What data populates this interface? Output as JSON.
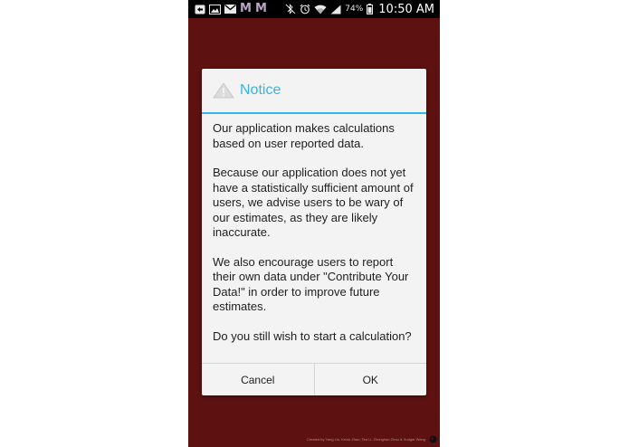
{
  "status_bar": {
    "icons_left": [
      "screenshot-icon",
      "gallery-icon",
      "gmail-icon",
      "m-app-icon",
      "m-app-icon"
    ],
    "m_glyph": "M",
    "icons_right": [
      "bluetooth-mute-icon",
      "alarm-icon",
      "wifi-icon",
      "signal-icon"
    ],
    "battery_percent": "74%",
    "time": "10:50 AM"
  },
  "dialog": {
    "title": "Notice",
    "paragraphs": [
      "Our application makes calculations based on user reported data.",
      "Because our application does not yet have a statistically sufficient amount of users, we advise users to be wary of our estimates, as they are likely inaccurate.",
      "We also encourage users to report their own data under \"Contribute Your Data!\" in order to improve future estimates.",
      "Do you still wish to start a calculation?"
    ],
    "cancel_label": "Cancel",
    "ok_label": "OK"
  },
  "footer": {
    "credits": "Created by Yang Liu, Kevin Zhao, Ted Li, Zhonghao Zhou & Xudgar Wang"
  },
  "colors": {
    "background": "#5e1111",
    "accent": "#33b5e5",
    "dialog_bg": "#f3f3f3"
  }
}
